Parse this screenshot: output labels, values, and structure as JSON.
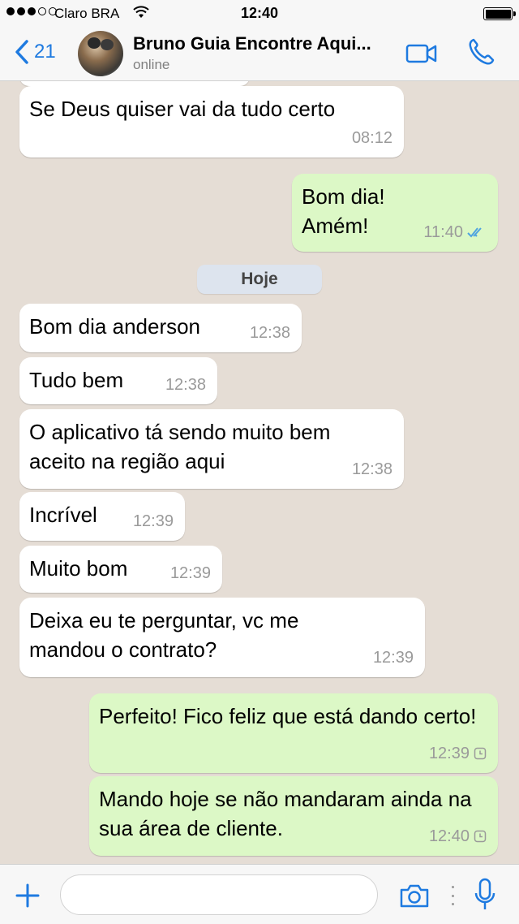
{
  "status_bar": {
    "carrier": "Claro BRA",
    "time": "12:40"
  },
  "header": {
    "back_count": "21",
    "contact_name": "Bruno Guia Encontre Aqui...",
    "contact_status": "online"
  },
  "chat": {
    "date_separator": "Hoje",
    "messages": [
      {
        "direction": "in",
        "text": "Se Deus quiser vai da tudo certo",
        "time": "08:12"
      },
      {
        "direction": "out",
        "text": "Bom dia!\nAmém!",
        "time": "11:40",
        "status": "read"
      },
      {
        "direction": "in",
        "text": "Bom dia anderson",
        "time": "12:38"
      },
      {
        "direction": "in",
        "text": "Tudo bem",
        "time": "12:38"
      },
      {
        "direction": "in",
        "text": "O aplicativo tá sendo muito bem aceito na região aqui",
        "time": "12:38"
      },
      {
        "direction": "in",
        "text": "Incrível",
        "time": "12:39"
      },
      {
        "direction": "in",
        "text": "Muito bom",
        "time": "12:39"
      },
      {
        "direction": "in",
        "text": "Deixa eu te perguntar,  vc me mandou o contrato?",
        "time": "12:39"
      },
      {
        "direction": "out",
        "text": "Perfeito! Fico feliz que está dando certo!",
        "time": "12:39",
        "status": "pending"
      },
      {
        "direction": "out",
        "text": "Mando hoje se não mandaram ainda na sua área de cliente.",
        "time": "12:40",
        "status": "pending"
      }
    ]
  },
  "input_bar": {
    "placeholder": ""
  },
  "colors": {
    "accent": "#1e7ae0",
    "incoming_bubble": "#ffffff",
    "outgoing_bubble": "#dcf8c6",
    "chat_background": "#e5ddd5",
    "read_ticks": "#4fa3e0"
  },
  "icons": [
    "wifi-icon",
    "battery-icon",
    "back-chevron-icon",
    "video-call-icon",
    "phone-icon",
    "double-check-icon",
    "clock-icon",
    "plus-icon",
    "camera-icon",
    "microphone-icon"
  ]
}
